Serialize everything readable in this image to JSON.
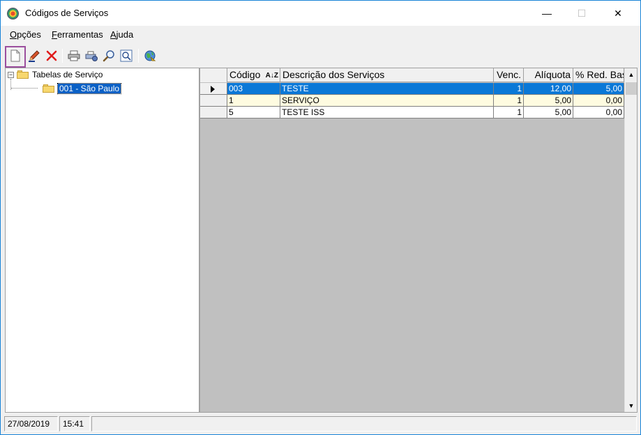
{
  "window": {
    "title": "Códigos de Serviços",
    "controls": {
      "minimize": "—",
      "maximize": "☐",
      "close": "✕"
    }
  },
  "menu": [
    {
      "key": "O",
      "rest": "pções"
    },
    {
      "key": "F",
      "rest": "erramentas"
    },
    {
      "key": "A",
      "rest": "juda"
    }
  ],
  "toolbar": {
    "icons": [
      "new-document-icon",
      "edit-pencil-icon",
      "delete-x-icon",
      "print-icon",
      "print-setup-icon",
      "search-icon",
      "preview-icon",
      "web-globe-icon"
    ],
    "accent_highlight": "#9b4f9e"
  },
  "tree": {
    "root": "Tabelas de Serviço",
    "root_expander": "−",
    "child": "001 - São Paulo"
  },
  "grid": {
    "columns": [
      "Código",
      "Descrição dos Serviços",
      "Venc.",
      "Alíquota",
      "% Red. Base"
    ],
    "sort_glyph": "A↓Z",
    "rows": [
      {
        "codigo": "003",
        "descricao": "TESTE",
        "venc": "1",
        "aliquota": "12,00",
        "red": "5,00",
        "selected": true
      },
      {
        "codigo": "1",
        "descricao": "SERVIÇO",
        "venc": "1",
        "aliquota": "5,00",
        "red": "0,00",
        "selected": false
      },
      {
        "codigo": "5",
        "descricao": "TESTE ISS",
        "venc": "1",
        "aliquota": "5,00",
        "red": "0,00",
        "selected": false
      }
    ],
    "scroll_up": "▲",
    "scroll_down": "▼",
    "selection_color": "#0a78d7"
  },
  "status": {
    "date": "27/08/2019",
    "time": "15:41"
  }
}
